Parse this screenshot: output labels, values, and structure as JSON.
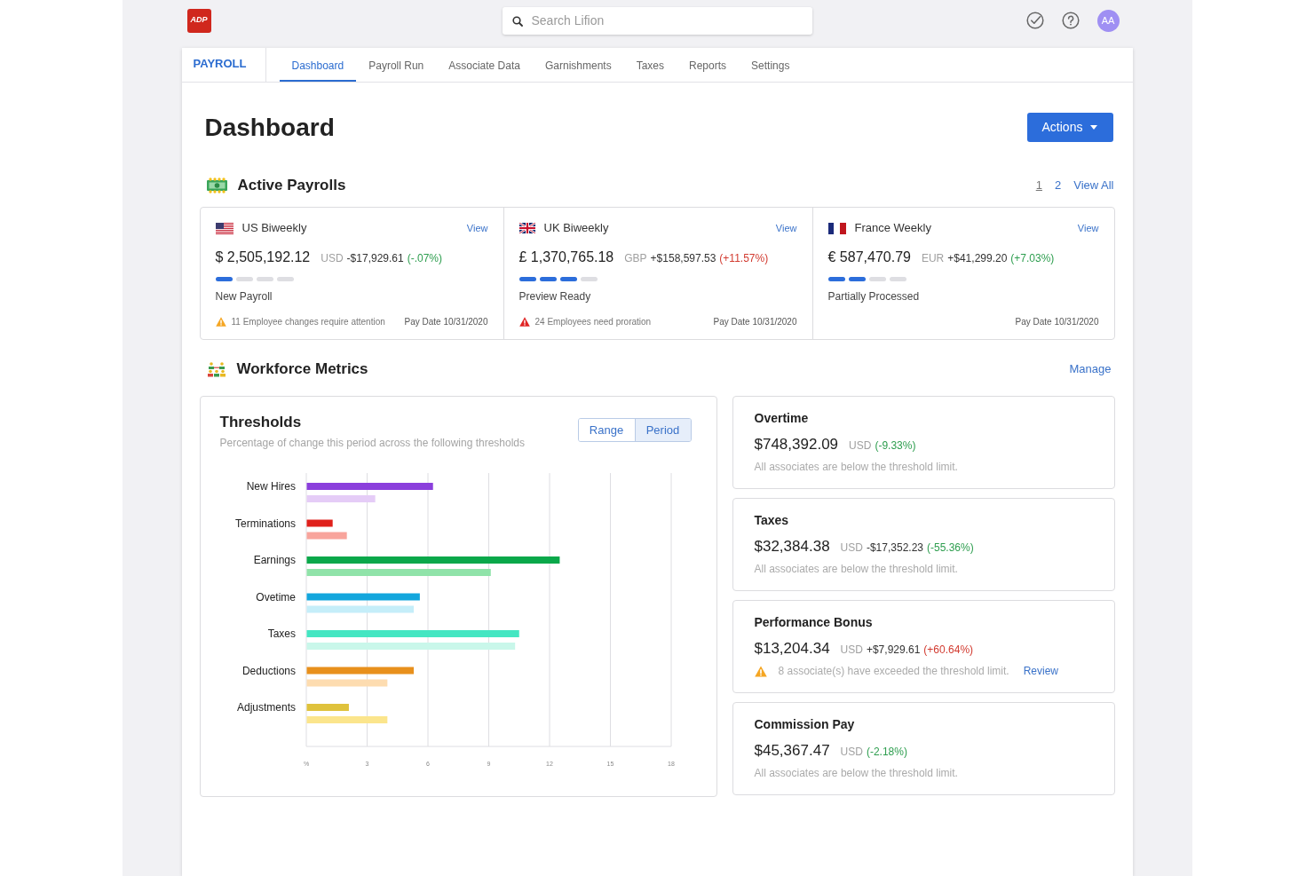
{
  "logo": {
    "text": "ADP"
  },
  "search": {
    "placeholder": "Search Lifion"
  },
  "user": {
    "initials": "AA"
  },
  "app_nav": {
    "section": "PAYROLL",
    "tabs": [
      {
        "label": "Dashboard",
        "selected": true
      },
      {
        "label": "Payroll Run",
        "selected": false
      },
      {
        "label": "Associate Data",
        "selected": false
      },
      {
        "label": "Garnishments",
        "selected": false
      },
      {
        "label": "Taxes",
        "selected": false
      },
      {
        "label": "Reports",
        "selected": false
      },
      {
        "label": "Settings",
        "selected": false
      }
    ]
  },
  "page": {
    "title": "Dashboard",
    "actions_button": "Actions"
  },
  "active_payrolls": {
    "title": "Active Payrolls",
    "pages": [
      {
        "label": "1",
        "selected": true
      },
      {
        "label": "2",
        "selected": false
      }
    ],
    "view_all": "View All",
    "payrolls": [
      {
        "name": "US Biweekly",
        "view": "View",
        "amount": "$ 2,505,192.12",
        "currency": "USD",
        "change": "-$17,929.61",
        "change_pct": {
          "text": "(-.07%)",
          "color": "#2e9e4f"
        },
        "steps": [
          {
            "complete": true
          },
          {
            "complete": false
          },
          {
            "complete": false
          },
          {
            "complete": false
          }
        ],
        "status": "New Payroll",
        "alert": {
          "color": "#f5a623",
          "text": "11 Employee changes require attention"
        },
        "pay_date": "Pay Date 10/31/2020"
      },
      {
        "name": "UK Biweekly",
        "view": "View",
        "amount": "£ 1,370,765.18",
        "currency": "GBP",
        "change": "+$158,597.53",
        "change_pct": {
          "text": "(+11.57%)",
          "color": "#d23b30"
        },
        "steps": [
          {
            "complete": true
          },
          {
            "complete": true
          },
          {
            "complete": true
          },
          {
            "complete": false
          }
        ],
        "status": "Preview Ready",
        "alert": {
          "color": "#e02424",
          "text": "24 Employees need proration"
        },
        "pay_date": "Pay Date 10/31/2020"
      },
      {
        "name": "France Weekly",
        "view": "View",
        "amount": "€ 587,470.79",
        "currency": "EUR",
        "change": "+$41,299.20",
        "change_pct": {
          "text": "(+7.03%)",
          "color": "#2e9e4f"
        },
        "steps": [
          {
            "complete": true
          },
          {
            "complete": true
          },
          {
            "complete": false
          },
          {
            "complete": false
          }
        ],
        "status": "Partially Processed",
        "pay_date": "Pay Date 10/31/2020"
      }
    ]
  },
  "workforce_metrics": {
    "title": "Workforce Metrics",
    "manage": "Manage",
    "thresholds": {
      "title": "Thresholds",
      "subtitle": "Percentage of change this period across the following thresholds",
      "toggle": [
        {
          "label": "Range",
          "selected": false
        },
        {
          "label": "Period",
          "selected": true
        }
      ],
      "chart_data": {
        "type": "bar",
        "orientation": "horizontal",
        "grid": true,
        "categories": [
          "New Hires",
          "Terminations",
          "Earnings",
          "Ovetime",
          "Taxes",
          "Deductions",
          "Adjustments"
        ],
        "series": [
          {
            "colors": [
              "#8b3fdc",
              "#e0201b",
              "#0aa84a",
              "#13a6dd",
              "#44e6c2",
              "#e8901c",
              "#dfc23c"
            ],
            "values": [
              6.25,
              1.3,
              12.5,
              5.6,
              10.5,
              5.3,
              2.1
            ]
          },
          {
            "colors": [
              "#e5ccf7",
              "#f8a49c",
              "#90e3a9",
              "#c5eef9",
              "#c9f7ea",
              "#fddcb0",
              "#fbe58c"
            ],
            "values": [
              3.4,
              2.0,
              9.1,
              5.3,
              10.3,
              4.0,
              4.0
            ]
          }
        ],
        "xlim": [
          0,
          18
        ],
        "xticks": [
          {
            "value": 0,
            "label": "%"
          },
          3,
          6,
          9,
          12,
          15,
          18
        ]
      }
    },
    "metrics": [
      {
        "title": "Overtime",
        "amount": "$748,392.09",
        "currency": "USD",
        "change_pct": {
          "text": "(-9.33%)",
          "color": "#2e9e4f"
        },
        "note": {
          "text": "All associates are below the threshold limit."
        }
      },
      {
        "title": "Taxes",
        "amount": "$32,384.38",
        "currency": "USD",
        "change": "-$17,352.23",
        "change_pct": {
          "text": "(-55.36%)",
          "color": "#2e9e4f"
        },
        "note": {
          "text": "All associates are below the threshold limit."
        }
      },
      {
        "title": "Performance Bonus",
        "amount": "$13,204.34",
        "currency": "USD",
        "change": "+$7,929.61",
        "change_pct": {
          "text": "(+60.64%)",
          "color": "#d23b30"
        },
        "note": {
          "warning": true,
          "text": "8 associate(s) have exceeded the threshold limit.",
          "link": "Review"
        }
      },
      {
        "title": "Commission Pay",
        "amount": "$45,367.47",
        "currency": "USD",
        "change_pct": {
          "text": "(-2.18%)",
          "color": "#2e9e4f"
        },
        "note": {
          "text": "All associates are below the threshold limit."
        }
      }
    ]
  }
}
